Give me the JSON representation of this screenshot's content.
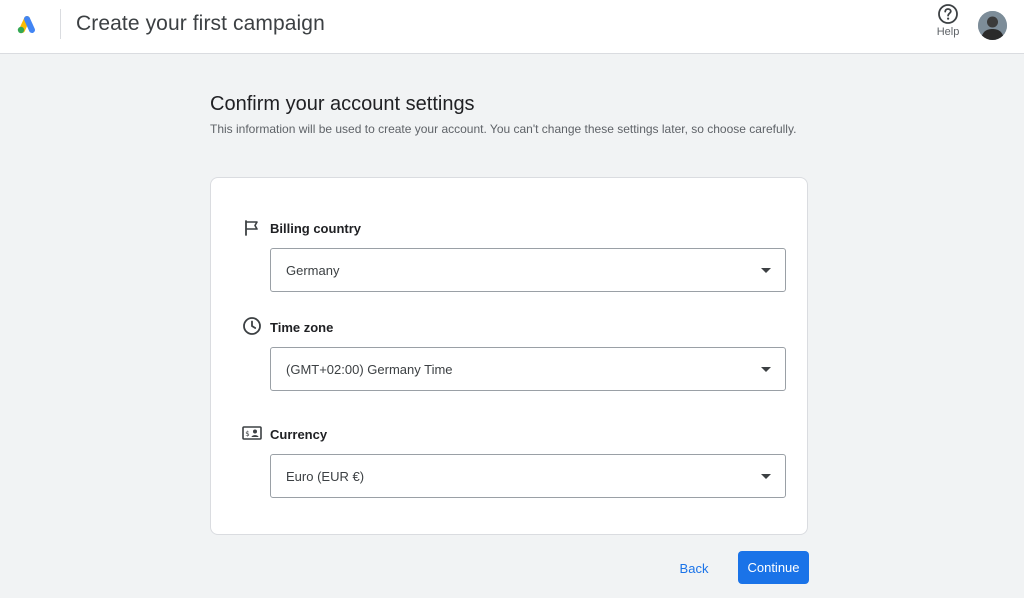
{
  "header": {
    "title": "Create your first campaign",
    "help_label": "Help"
  },
  "main": {
    "heading": "Confirm your account settings",
    "description": "This information will be used to create your account. You can't change these settings later, so choose carefully."
  },
  "fields": [
    {
      "label": "Billing country",
      "icon": "flag-icon",
      "value": "Germany"
    },
    {
      "label": "Time zone",
      "icon": "clock-icon",
      "value": "(GMT+02:00) Germany Time"
    },
    {
      "label": "Currency",
      "icon": "currency-icon",
      "value": "Euro (EUR €)"
    }
  ],
  "actions": {
    "back_label": "Back",
    "continue_label": "Continue"
  },
  "colors": {
    "accent": "#1a73e8",
    "background": "#f1f3f4"
  }
}
